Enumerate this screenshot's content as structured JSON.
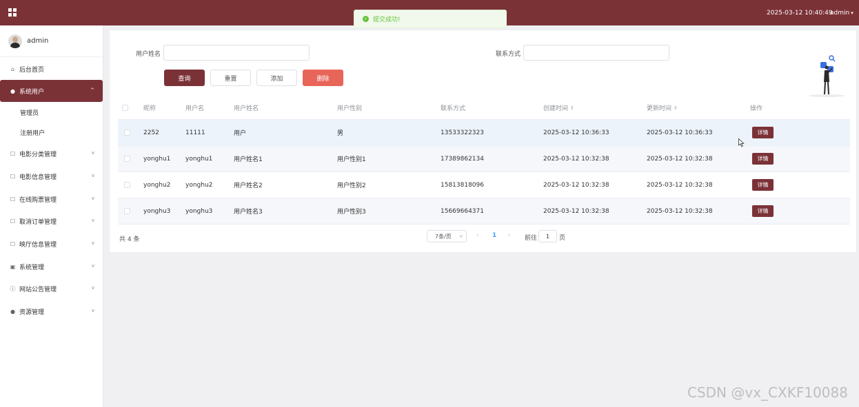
{
  "header": {
    "datetime": "2025-03-12 10:40:49",
    "user": "admin"
  },
  "toast": {
    "text": "提交成功!"
  },
  "sidebar": {
    "profile_name": "admin",
    "items": [
      {
        "label": "后台首页",
        "icon": "home-icon"
      },
      {
        "label": "系统用户",
        "icon": "user-icon",
        "active": true
      },
      {
        "label": "电影分类管理",
        "icon": "edit-icon"
      },
      {
        "label": "电影信息管理",
        "icon": "edit-icon"
      },
      {
        "label": "在线购票管理",
        "icon": "edit-icon"
      },
      {
        "label": "取消订单管理",
        "icon": "edit-icon"
      },
      {
        "label": "映厅信息管理",
        "icon": "edit-icon"
      },
      {
        "label": "系统管理",
        "icon": "picture-icon"
      },
      {
        "label": "网站公告管理",
        "icon": "info-icon"
      },
      {
        "label": "资源管理",
        "icon": "location-icon"
      }
    ],
    "sub_items": [
      "管理员",
      "注册用户"
    ]
  },
  "search": {
    "name_label": "用户姓名",
    "contact_label": "联系方式",
    "name_value": "",
    "contact_value": ""
  },
  "buttons": {
    "query": "查询",
    "reset": "重置",
    "add": "添加",
    "delete": "删除"
  },
  "table": {
    "columns": [
      "昵称",
      "用户名",
      "用户姓名",
      "用户性别",
      "联系方式",
      "创建时间",
      "更新时间",
      "操作"
    ],
    "rows": [
      [
        "2252",
        "11111",
        "用户",
        "男",
        "13533322323",
        "2025-03-12 10:36:33",
        "2025-03-12 10:36:33"
      ],
      [
        "yonghu1",
        "yonghu1",
        "用户姓名1",
        "用户性别1",
        "17389862134",
        "2025-03-12 10:32:38",
        "2025-03-12 10:32:38"
      ],
      [
        "yonghu2",
        "yonghu2",
        "用户姓名2",
        "用户性别2",
        "15813818096",
        "2025-03-12 10:32:38",
        "2025-03-12 10:32:38"
      ],
      [
        "yonghu3",
        "yonghu3",
        "用户姓名3",
        "用户性别3",
        "15669664371",
        "2025-03-12 10:32:38",
        "2025-03-12 10:32:38"
      ]
    ],
    "detail_label": "详情"
  },
  "pagination": {
    "total": "共 4 条",
    "page_size": "7条/页",
    "current_page": "1",
    "goto_label": "前往",
    "goto_value": "1",
    "goto_unit": "页"
  },
  "watermark": "CSDN @vx_CXKF10088",
  "colors": {
    "brand": "#7b3237",
    "danger": "#e8655a",
    "success": "#67c23a",
    "link": "#409eff"
  }
}
